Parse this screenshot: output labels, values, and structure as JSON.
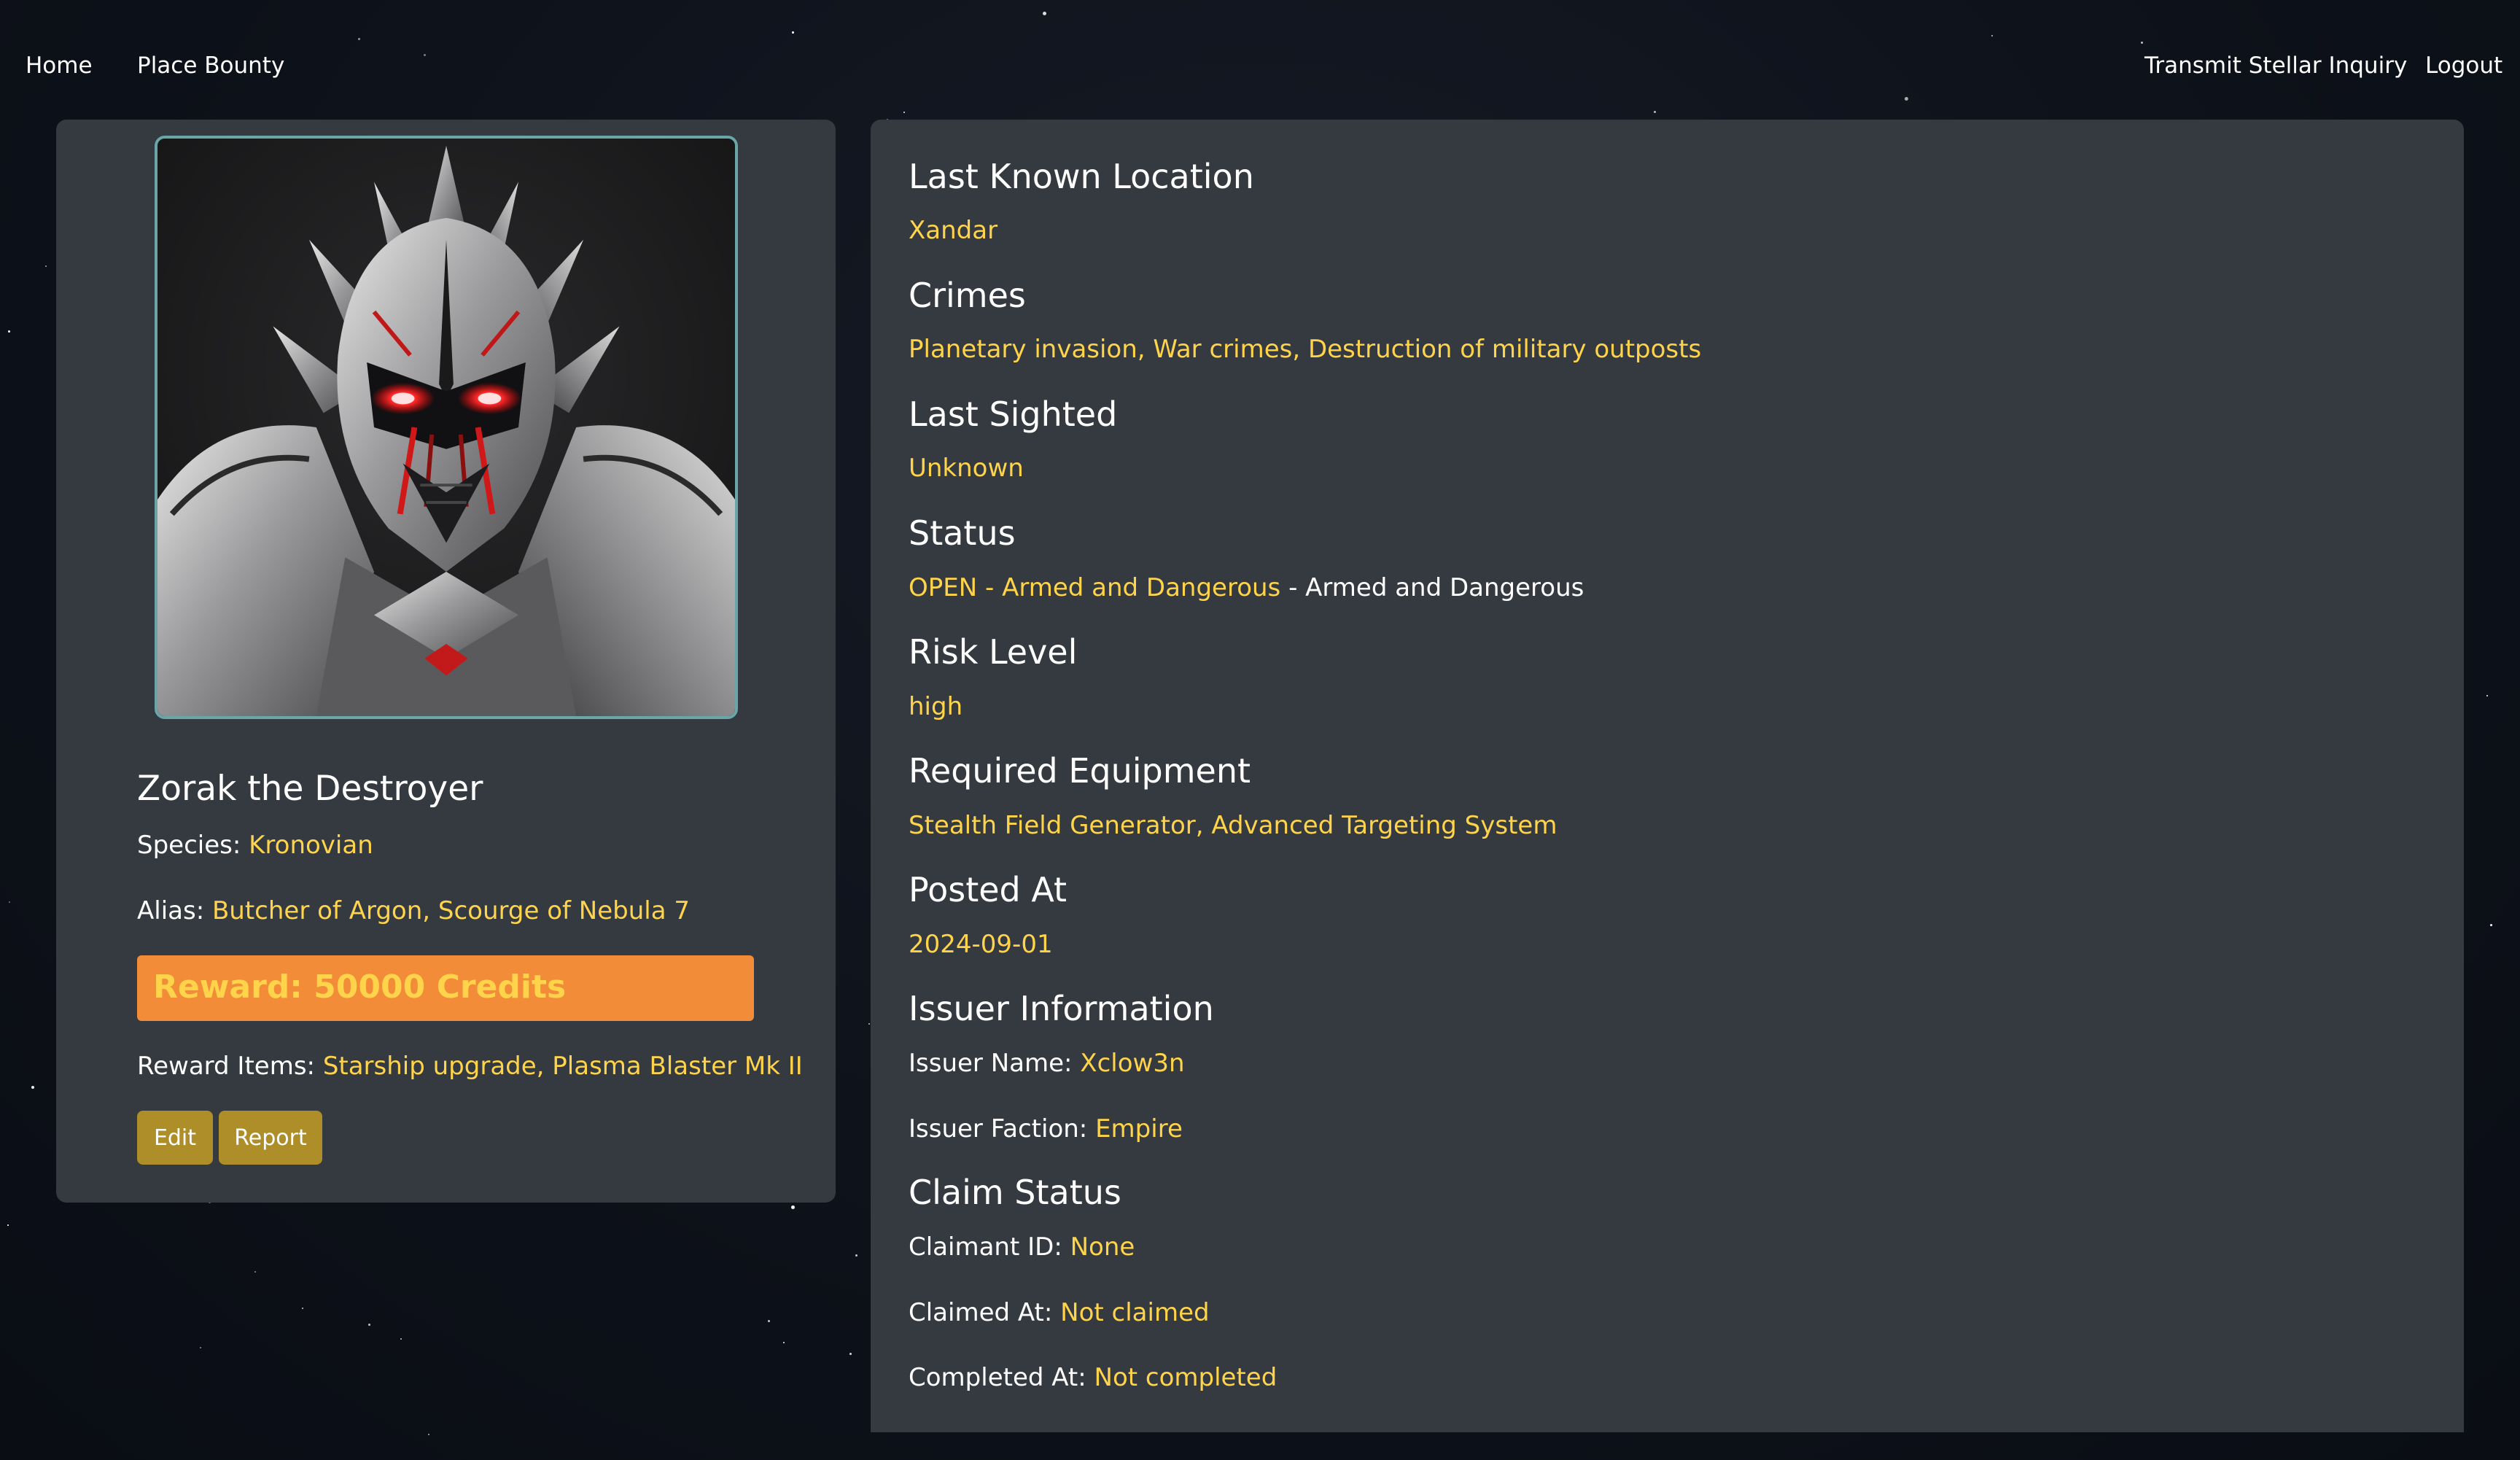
{
  "nav": {
    "home": "Home",
    "place_bounty": "Place Bounty",
    "transmit_inquiry": "Transmit Stellar Inquiry",
    "logout": "Logout"
  },
  "bounty": {
    "name": "Zorak the Destroyer",
    "species_label": "Species:",
    "species": "Kronovian",
    "alias_label": "Alias:",
    "alias": "Butcher of Argon, Scourge of Nebula 7",
    "reward": "Reward: 50000 Credits",
    "reward_items_label": "Reward Items:",
    "reward_items": "Starship upgrade, Plasma Blaster Mk II",
    "edit_button": "Edit",
    "report_button": "Report"
  },
  "details": {
    "last_known_location": {
      "heading": "Last Known Location",
      "value": "Xandar"
    },
    "crimes": {
      "heading": "Crimes",
      "value": "Planetary invasion, War crimes, Destruction of military outposts"
    },
    "last_sighted": {
      "heading": "Last Sighted",
      "value": "Unknown"
    },
    "status": {
      "heading": "Status",
      "value": "OPEN - Armed and Dangerous",
      "suffix": " - Armed and Dangerous"
    },
    "risk_level": {
      "heading": "Risk Level",
      "value": "high"
    },
    "required_equipment": {
      "heading": "Required Equipment",
      "value": "Stealth Field Generator, Advanced Targeting System"
    },
    "posted_at": {
      "heading": "Posted At",
      "value": "2024-09-01"
    },
    "issuer": {
      "heading": "Issuer Information",
      "name_label": "Issuer Name:",
      "name": "Xclow3n",
      "faction_label": "Issuer Faction:",
      "faction": "Empire"
    },
    "claim": {
      "heading": "Claim Status",
      "claimant_label": "Claimant ID:",
      "claimant": "None",
      "claimed_at_label": "Claimed At:",
      "claimed_at": "Not claimed",
      "completed_at_label": "Completed At:",
      "completed_at": "Not completed"
    }
  },
  "colors": {
    "accent_yellow": "#ffd44a",
    "reward_orange": "#f28c38",
    "button_gold": "#ad8e28",
    "panel": "#343a40"
  }
}
